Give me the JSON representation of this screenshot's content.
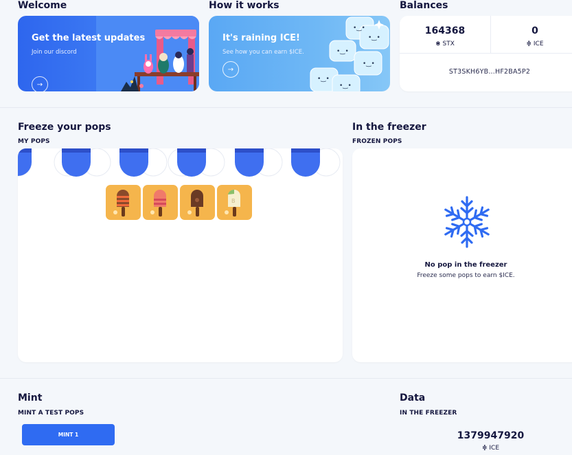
{
  "welcome": {
    "heading": "Welcome",
    "card_title": "Get the latest updates",
    "card_sub": "Join our discord",
    "arrow": "→"
  },
  "how": {
    "heading": "How it works",
    "card_title": "It's raining ICE!",
    "card_sub": "See how you can earn $ICE.",
    "arrow": "→"
  },
  "balances": {
    "heading": "Balances",
    "stx_value": "164368",
    "stx_label": "STX",
    "stx_icon": "stx-icon",
    "ice_value": "0",
    "ice_label": "ICE",
    "ice_icon": "ice-icon",
    "address": "ST3SKH6YB...HF2BA5P2"
  },
  "freeze": {
    "heading": "Freeze your pops",
    "sub": "MY POPS",
    "pops": [
      "striped pop",
      "pink pop",
      "chocolate pop",
      "vanilla pop"
    ]
  },
  "freezer": {
    "heading": "In the freezer",
    "sub": "FROZEN POPS",
    "empty_title": "No pop in the freezer",
    "empty_sub": "Freeze some pops to earn $ICE.",
    "icon": "snowflake-icon"
  },
  "mint": {
    "heading": "Mint",
    "sub": "MINT A TEST POPS",
    "button": "MINT 1"
  },
  "data": {
    "heading": "Data",
    "sub": "IN THE FREEZER",
    "value": "1379947920",
    "unit": "ICE"
  },
  "colors": {
    "accent": "#2f6bf2",
    "pop_tile": "#f5b54c",
    "promo_blue": "#3a74f0",
    "promo_light": "#6fb8f5"
  }
}
